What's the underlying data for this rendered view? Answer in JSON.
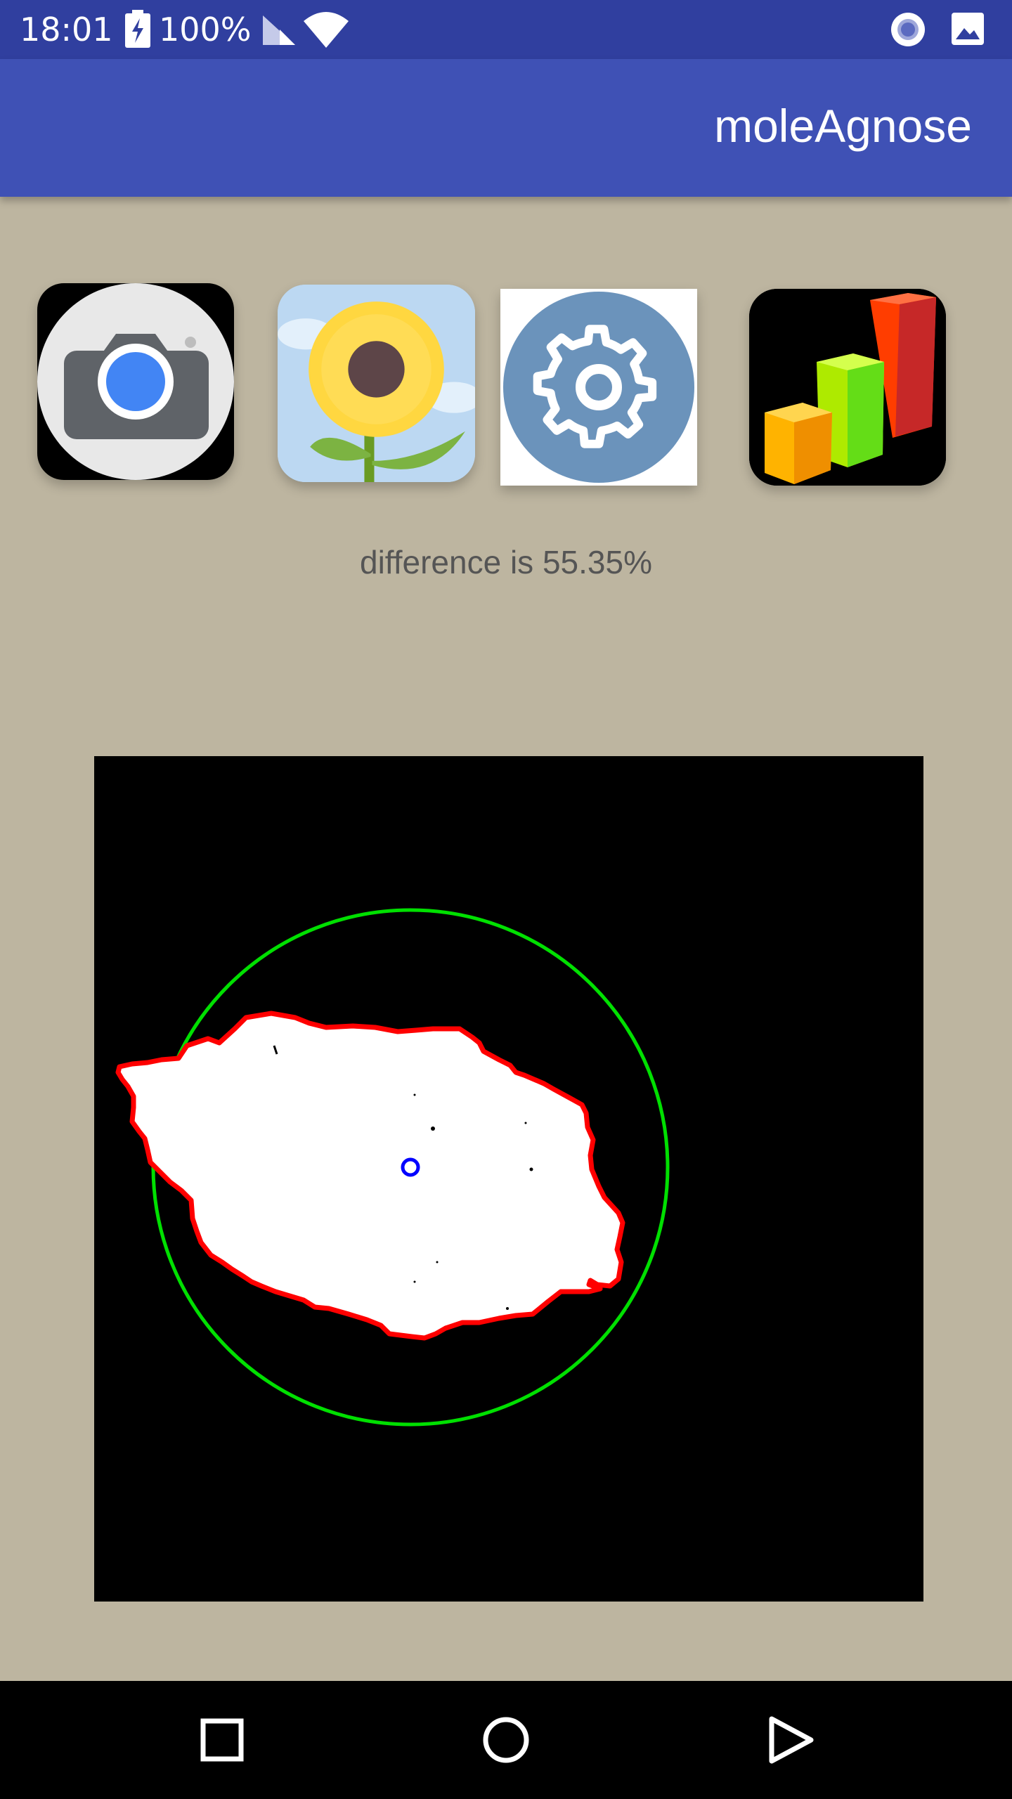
{
  "status_bar": {
    "time": "18:01",
    "battery": "100%",
    "icons": [
      "battery-charging-icon",
      "cell-signal-icon",
      "wifi-icon",
      "screen-record-icon",
      "image-notification-icon"
    ]
  },
  "app_bar": {
    "title": "moleAgnose"
  },
  "toolbar": {
    "buttons": [
      {
        "name": "camera",
        "icon": "camera-icon"
      },
      {
        "name": "gallery",
        "icon": "sunflower-gallery-icon"
      },
      {
        "name": "settings",
        "icon": "gear-icon"
      },
      {
        "name": "statistics",
        "icon": "bar-chart-icon"
      }
    ]
  },
  "result": {
    "text": "difference is 55.35%"
  },
  "analysis": {
    "overlay_colors": {
      "lesion_outline": "#ff0000",
      "enclosing_circle": "#00e000",
      "centroid_marker": "#0000ff"
    }
  },
  "nav_bar": {
    "buttons": [
      "recents",
      "home",
      "back"
    ]
  },
  "colors": {
    "status_bar": "#303f9f",
    "app_bar": "#3f51b5",
    "background": "#bdb5a0"
  }
}
